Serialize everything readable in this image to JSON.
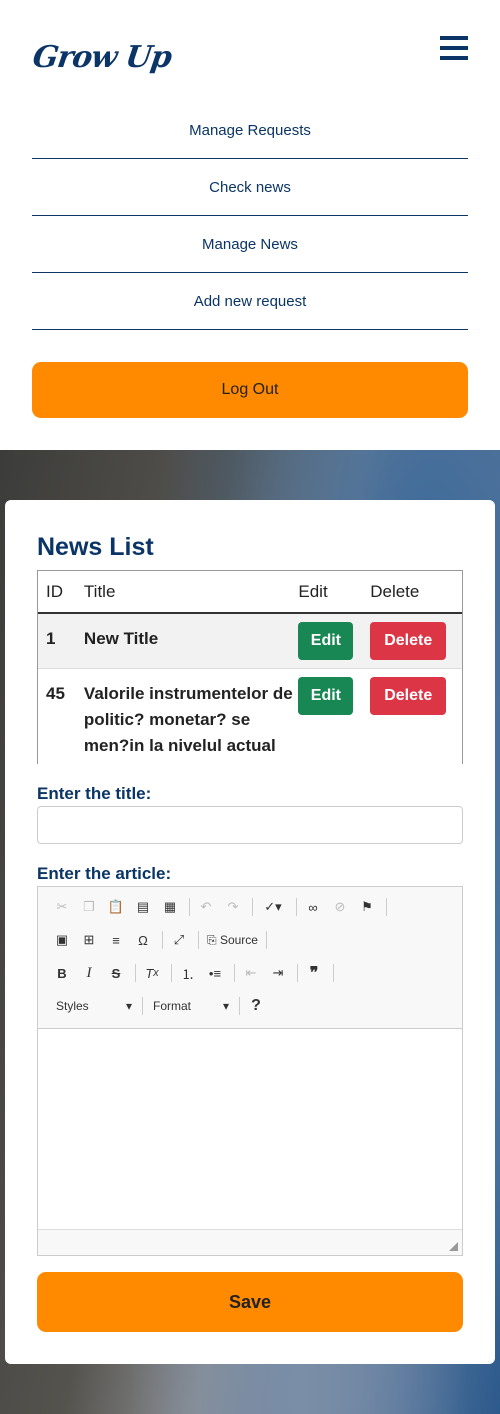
{
  "header": {
    "logo": "Grow Up",
    "nav": [
      "Manage Requests",
      "Check news",
      "Manage News",
      "Add new request"
    ],
    "logout_label": "Log Out"
  },
  "card": {
    "title": "News List",
    "table": {
      "headers": [
        "ID",
        "Title",
        "Edit",
        "Delete"
      ],
      "rows": [
        {
          "id": "1",
          "title": "New Title",
          "edit": "Edit",
          "delete": "Delete"
        },
        {
          "id": "45",
          "title": "Valorile instrumentelor de politic? monetar? se men?in la nivelul actual",
          "edit": "Edit",
          "delete": "Delete"
        }
      ]
    },
    "title_label": "Enter the title:",
    "title_value": "",
    "article_label": "Enter the article:",
    "editor": {
      "source_label": "Source",
      "styles_label": "Styles",
      "format_label": "Format"
    },
    "save_label": "Save"
  },
  "colors": {
    "brand": "#0b3566",
    "accent": "#ff8a00",
    "edit": "#198754",
    "delete": "#dc3545"
  }
}
